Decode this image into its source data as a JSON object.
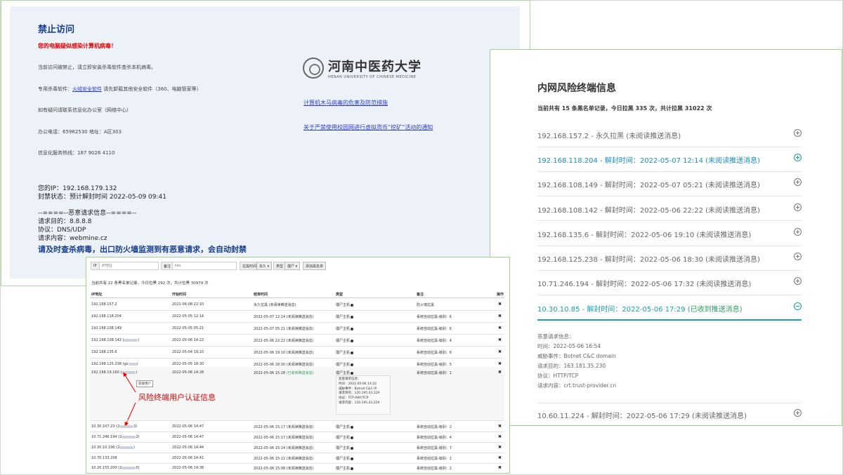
{
  "block_page": {
    "title": "禁止访问",
    "alert": "您的电脑疑似感染计算机病毒！",
    "line_access": "当前访问被禁止，请立即安装杀毒软件查杀本机病毒。",
    "av_prefix": "专用杀毒软件：",
    "av_link": "火绒安全软件",
    "av_suffix": "请先卸载其他安全软件（360、电脑管家等）",
    "contact": "如有疑问请联系信息化办公室（网络中心）",
    "phone": "办公电话：65962530    地址：A区303",
    "hotline": "信息化服务热线：187 9026 4110",
    "ip": "您的IP：192.168.179.132",
    "status": "封禁状态：预计解封时间 2022-05-09 09:41",
    "divider": "--====--恶意请求信息--====--",
    "target": "请求目的：8.8.8.8",
    "protocol": "协议：DNS/UDP",
    "content": "请求内容：webmine.cz",
    "warning": "请及时查杀病毒，出口防火墙监测到有恶意请求，会自动封禁",
    "logo_cn": "河南中医药大学",
    "logo_en": "HENAN UNIVERSITY OF CHINESE MEDICINE",
    "link1": "计算机木马病毒的危害及防范措施",
    "link2": "关于严禁使用校园网进行虚拟货币“挖矿”活动的通知"
  },
  "risk_panel": {
    "title": "内网风险终端信息",
    "summary": "当前共有 15 条黑名单记录，今日拉黑 335 次，共计拉黑 31022 次",
    "items": [
      "192.168.157.2 - 永久拉黑 (未阅读推送消息)",
      "192.168.118.204 - 解封时间：2022-05-07 12:14 (未阅读推送消息)",
      "192.168.108.149 - 解封时间：2022-05-07 05:21 (未阅读推送消息)",
      "192.168.108.142 - 解封时间：2022-05-06 22:22 (未阅读推送消息)",
      "192.168.135.6 - 解封时间：2022-05-06 19:10 (未阅读推送消息)",
      "192.168.125.238 - 解封时间：2022-05-06 18:30 (未阅读推送消息)",
      "10.71.246.194 - 解封时间：2022-05-06 17:32 (未阅读推送消息)"
    ],
    "open_item": "10.30.10.85 - 解封时间：2022-05-06 17:29 ",
    "open_item_status": "(已收到推送消息)",
    "detail": {
      "head": "恶意请求信息：",
      "time": "时间：2022-05-06 16:54",
      "event": "威胁事件：Botnet C&C domain",
      "target": "请求目的：163.181.35.230",
      "protocol": "协议：HTTP/TCP",
      "content": "请求内容：crt.trust-provider.cn"
    },
    "last_item": "10.60.11.224 - 解封时间：2022-05-06 17:29 (未阅读推送消息)"
  },
  "table_panel": {
    "filter": {
      "ip_label": "IP",
      "ip_placeholder": "IP地址",
      "note_label": "备注",
      "note_placeholder": "Info",
      "duration_label": "拉黑时间",
      "duration_value": "永久 ▾",
      "type_label": "类型",
      "type_value": "僵尸 ▾",
      "add_button": "添加黑名单"
    },
    "summary": "当前共有 22 条黑名单记录，今日拉黑 292 次，共计拉黑 30979 次",
    "headers": [
      "IP地址",
      "开始时间",
      "结束时间",
      "类型",
      "备注",
      "操作"
    ],
    "rows": [
      {
        "ip": "192.168.157.2",
        "start": "2021-06-08 22:10",
        "end": "永久拉黑 (未阅读推送消息)",
        "type": "僵尸主机",
        "note": "防火墙拉黑"
      },
      {
        "ip": "192.168.118.204",
        "start": "2022-05-05 12:14",
        "end": "2022-05-07 12:14 (未阅读推送消息)",
        "type": "僵尸主机",
        "note": "系统自动拉黑-级别：6"
      },
      {
        "ip": "192.168.108.149",
        "start": "2022-05-05 05:21",
        "end": "2022-05-07 05:21 (未阅读推送消息)",
        "type": "僵尸主机",
        "note": "系统自动拉黑-级别：6"
      },
      {
        "ip": "192.168.108.142 (",
        "start": "2022-05-06 14:22",
        "end": "2022-05-06 22:22 (未阅读推送消息)",
        "type": "僵尸主机",
        "note": "系统自动拉黑-级别：4"
      },
      {
        "ip": "192.168.135.6",
        "start": "2022-05-04 19:10",
        "end": "2022-05-06 19:10 (未阅读推送消息)",
        "type": "僵尸主机",
        "note": "系统自动拉黑-级别：6"
      },
      {
        "ip": "192.168.125.238 (gx",
        "start": "2022-05-05 18:30",
        "end": "2022-05-06 18:30 (未阅读推送消息)",
        "type": "僵尸主机",
        "note": "系统自动拉黑-级别：5"
      }
    ],
    "expanded": {
      "ip": "192.168.19.160 (",
      "start": "2022-05-06 14:28",
      "end": "2022-05-06 15:28",
      "end_status": "(已收到推送消息)",
      "type": "僵尸主机",
      "note": "系统自动拉黑-级别：1",
      "auth_button": "获取用户",
      "detail_head": "恶意请求信息：",
      "detail_time": "时间：2022-05-06 14:22",
      "detail_event": "威胁事件：Botnet C&C IP",
      "detail_target": "请求目的：120.195.43.229",
      "detail_protocol": "协议：TCP-ANY/TCP",
      "detail_content": "请求内容：120.195.43.229"
    },
    "rows2": [
      {
        "ip": "10.30.107.23 (2",
        "start": "2022-05-06 14:47",
        "end": "2022-05-06 15:17 (未阅读推送消息)",
        "type": "僵尸主机",
        "note": "系统自动拉黑-级别：2"
      },
      {
        "ip": "10.71.246.194 (2",
        "start": "2022-05-06 14:47",
        "end": "2022-05-06 15:17 (未阅读推送消息)",
        "type": "僵尸主机",
        "note": "系统自动拉黑-级别：4"
      },
      {
        "ip": "10.30.10.196 (2",
        "start": "2022-05-06 14:44",
        "end": "2022-05-06 15:14 (未阅读推送消息)",
        "type": "僵尸主机",
        "note": "系统自动拉黑-级别：7"
      },
      {
        "ip": "10.70.133.208",
        "start": "2022-05-06 14:41",
        "end": "2022-05-06 15:11 (未阅读推送消息)",
        "type": "僵尸主机",
        "note": "系统自动拉黑-级别：1"
      },
      {
        "ip": "10.20.155.200 (2",
        "start": "2022-05-06 14:38",
        "end": "2022-05-06 15:08 (未阅读推送消息)",
        "type": "僵尸主机",
        "note": "系统自动拉黑-级别：2"
      }
    ],
    "annotation": "风险终端用户认证信息"
  }
}
